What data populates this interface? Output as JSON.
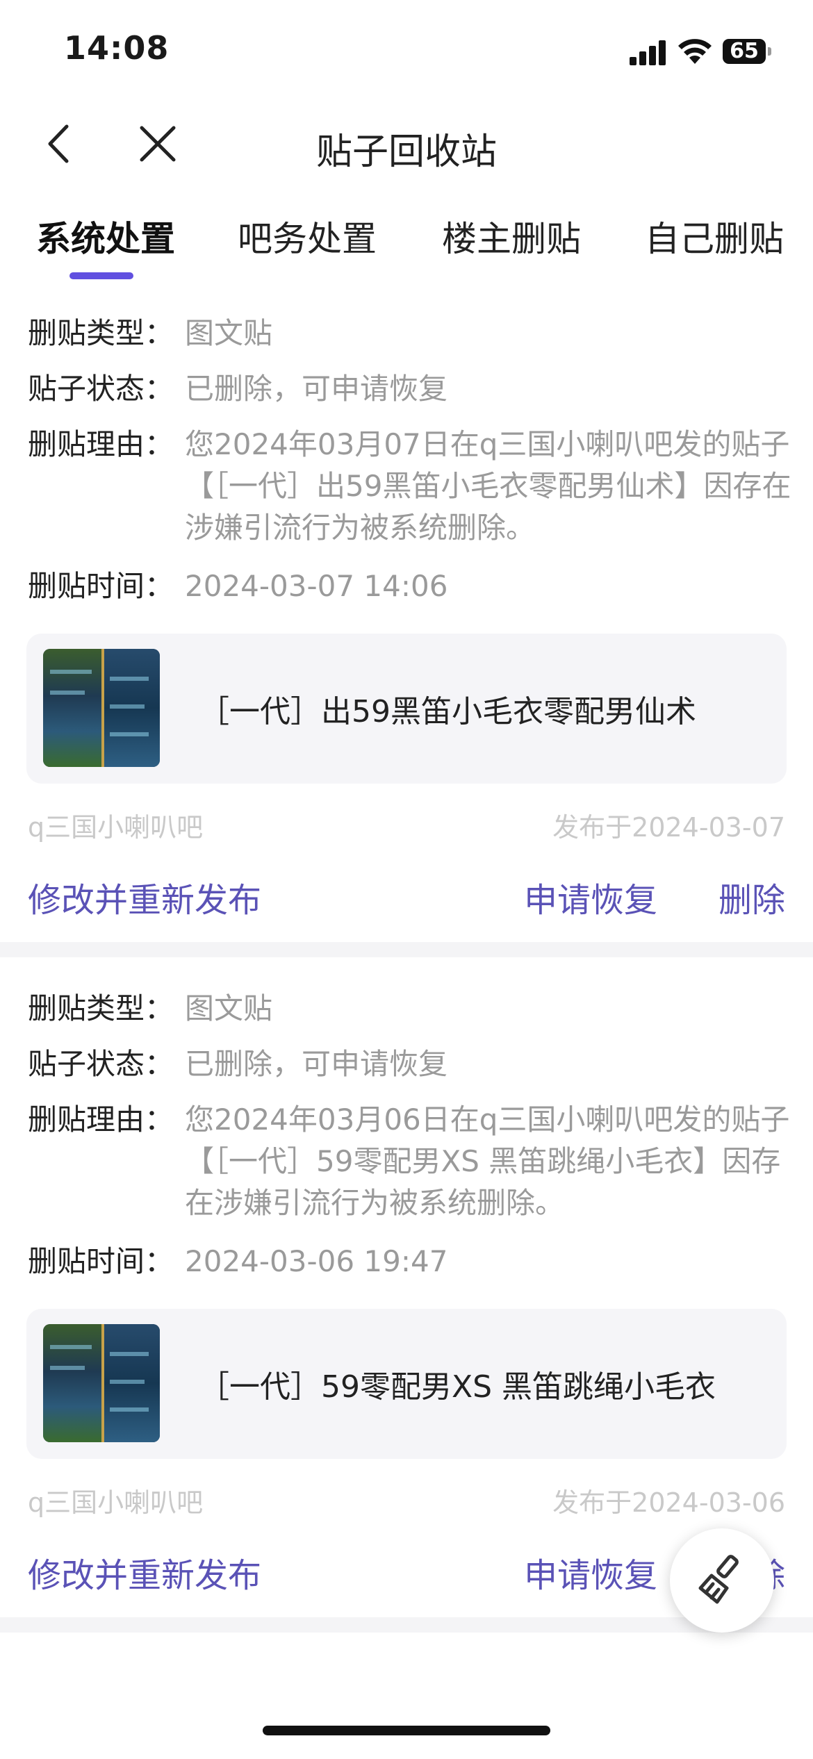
{
  "status_bar": {
    "time": "14:08",
    "battery": "65"
  },
  "nav": {
    "title": "贴子回收站"
  },
  "tabs": [
    {
      "label": "系统处置",
      "active": true
    },
    {
      "label": "吧务处置",
      "active": false
    },
    {
      "label": "楼主删贴",
      "active": false
    },
    {
      "label": "自己删贴",
      "active": false
    }
  ],
  "labels": {
    "type": "删贴类型：",
    "status": "贴子状态：",
    "reason": "删贴理由：",
    "time": "删贴时间：",
    "edit_repost": "修改并重新发布",
    "restore": "申请恢复",
    "delete": "删除"
  },
  "posts": [
    {
      "type": "图文贴",
      "status": "已删除，可申请恢复",
      "reason": "您2024年03月07日在q三国小喇叭吧发的贴子【［一代］出59黑笛小毛衣零配男仙术】因存在涉嫌引流行为被系统删除。",
      "time": "2024-03-07 14:06",
      "title": "［一代］出59黑笛小毛衣零配男仙术",
      "forum": "q三国小喇叭吧",
      "published": "发布于2024-03-07"
    },
    {
      "type": "图文贴",
      "status": "已删除，可申请恢复",
      "reason": "您2024年03月06日在q三国小喇叭吧发的贴子【［一代］59零配男XS 黑笛跳绳小毛衣】因存在涉嫌引流行为被系统删除。",
      "time": "2024-03-06 19:47",
      "title": "［一代］59零配男XS 黑笛跳绳小毛衣",
      "forum": "q三国小喇叭吧",
      "published": "发布于2024-03-06"
    }
  ],
  "colors": {
    "accent": "#5a52b6",
    "tab_indicator": "#6150e0",
    "muted_text": "#9a9a9a"
  },
  "icons": {
    "back": "chevron-left-icon",
    "close": "close-icon",
    "fab": "broom-icon"
  }
}
